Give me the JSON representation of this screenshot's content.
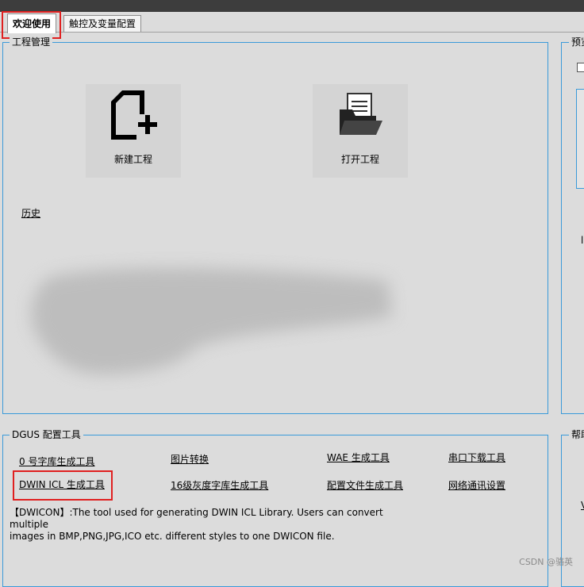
{
  "tabs": [
    "欢迎使用",
    "触控及变量配置"
  ],
  "project": {
    "title": "工程管理",
    "new_label": "新建工程",
    "open_label": "打开工程",
    "history_label": "历史"
  },
  "preview": {
    "title": "预览"
  },
  "tools": {
    "title": "DGUS 配置工具",
    "items": [
      "0 号字库生成工具",
      "图片转换",
      "WAE 生成工具",
      "串口下载工具",
      "DWIN ICL 生成工具",
      "16级灰度字库生成工具",
      "配置文件生成工具",
      "网络通讯设置"
    ],
    "desc_line1": "【DWICON】:The tool used for generating DWIN ICL Library. Users can convert multiple",
    "desc_line2": "images in BMP,PNG,JPG,ICO etc. different styles to one DWICON file."
  },
  "help": {
    "title": "帮助"
  },
  "watermark": "CSDN @骆英",
  "colors": {
    "accent_border": "#3a9ad9",
    "highlight": "#e02020"
  }
}
